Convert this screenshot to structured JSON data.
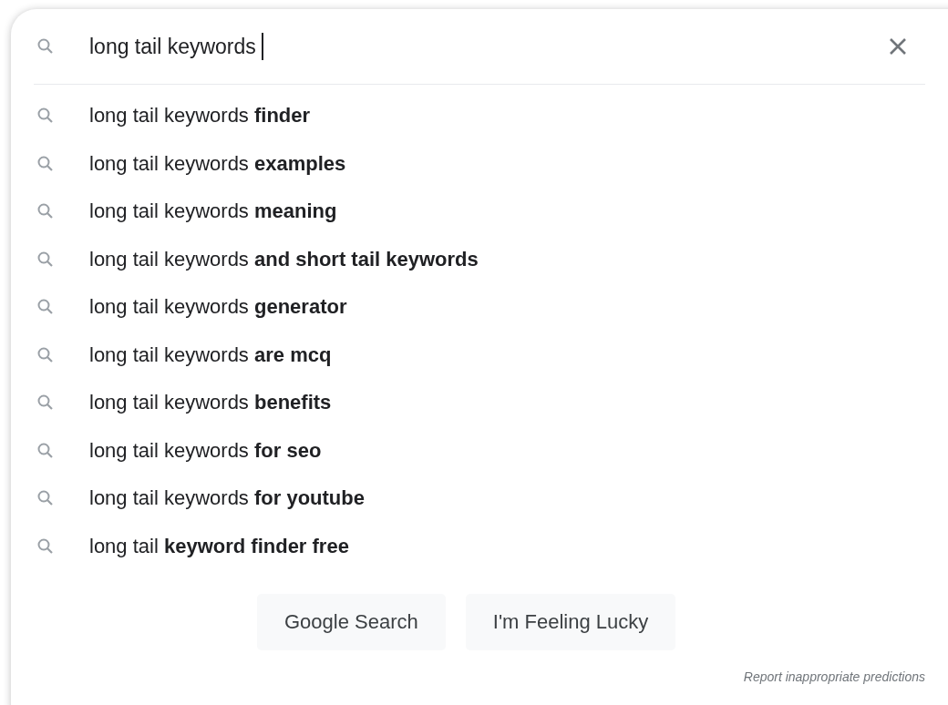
{
  "search": {
    "value": "long tail keywords"
  },
  "suggestions": [
    {
      "text": "long tail keywords **finder**"
    },
    {
      "text": "long tail keywords **examples**"
    },
    {
      "text": "long tail keywords **meaning**"
    },
    {
      "text": "long tail keywords **and short tail keywords**"
    },
    {
      "text": "long tail keywords **generator**"
    },
    {
      "text": "long tail keywords **are mcq**"
    },
    {
      "text": "long tail keywords **benefits**"
    },
    {
      "text": "long tail keywords **for seo**"
    },
    {
      "text": "long tail keywords **for youtube**"
    },
    {
      "text": "long tail **keyword finder free**"
    }
  ],
  "buttons": [
    "Google Search",
    "I'm Feeling Lucky"
  ],
  "report_link": "Report inappropriate predictions"
}
